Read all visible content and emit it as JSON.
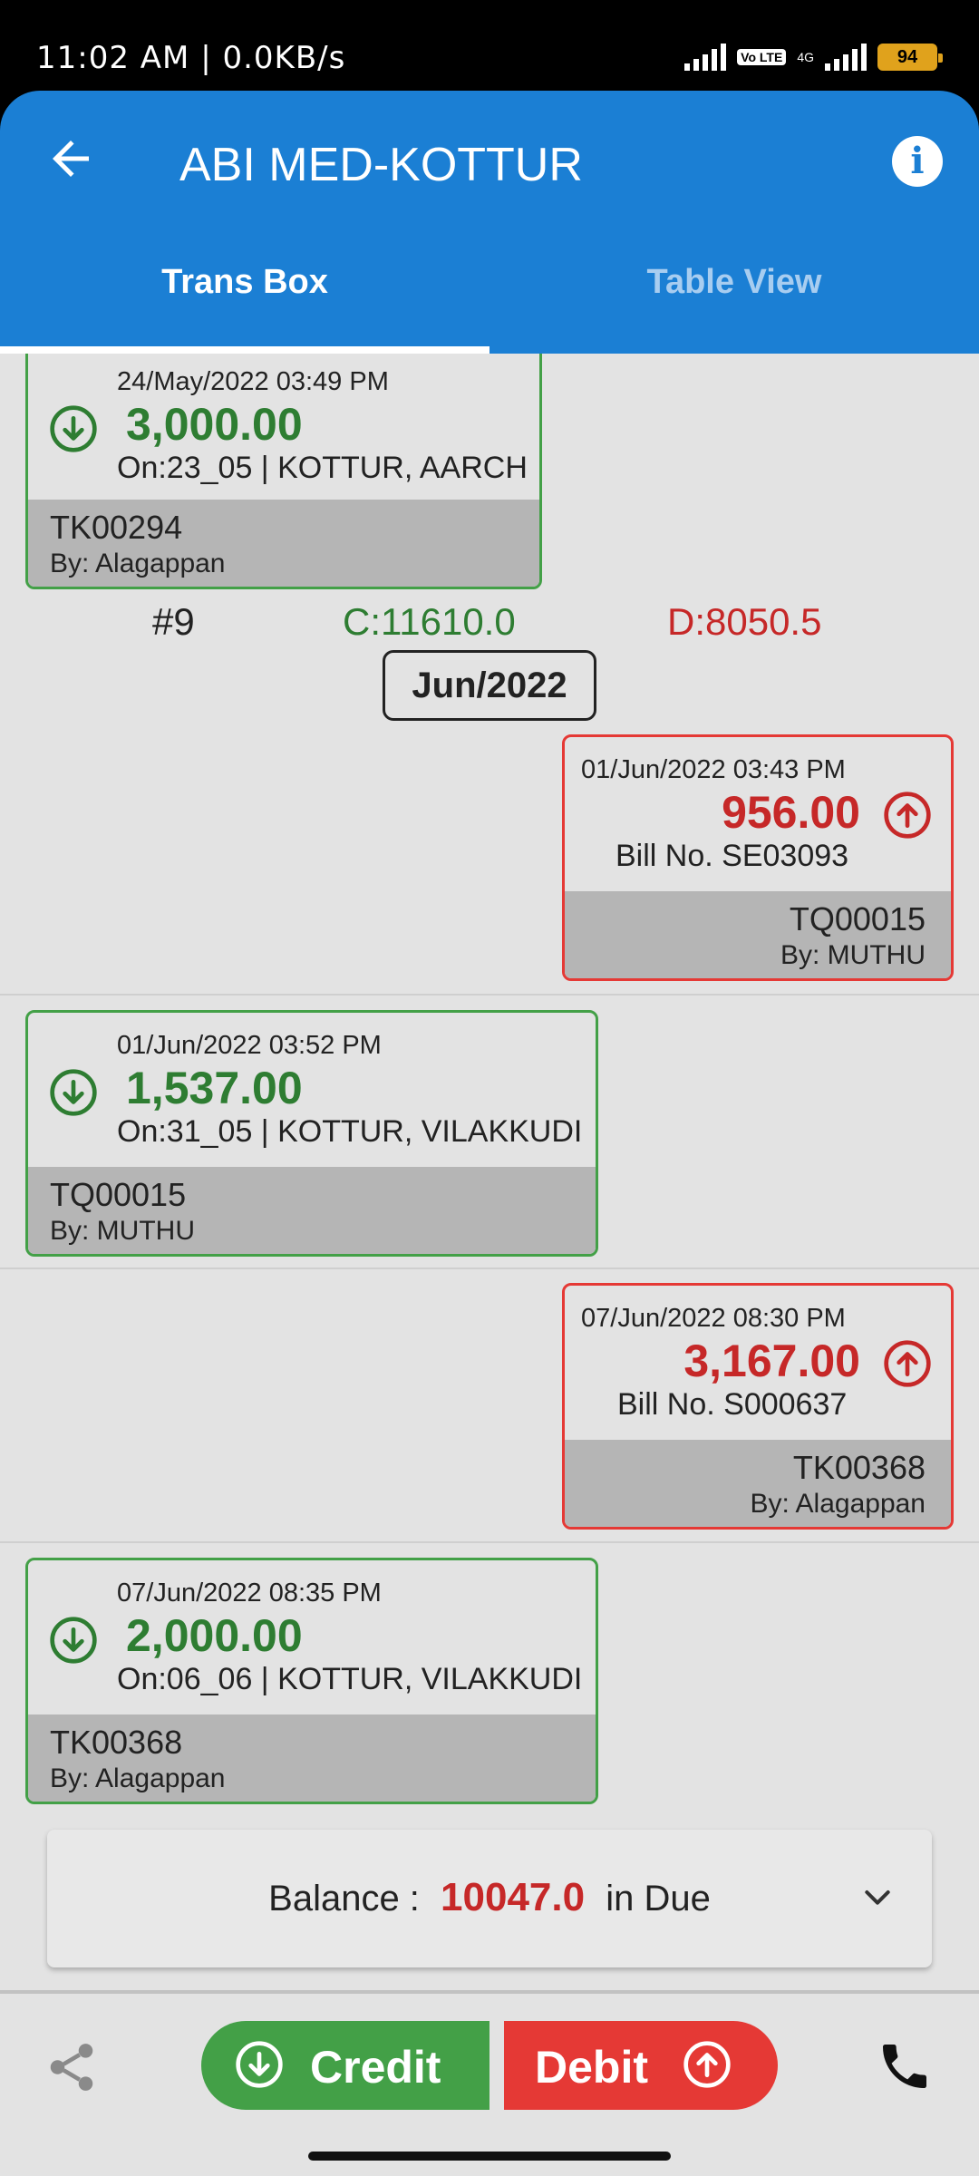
{
  "status_bar": {
    "time": "11:02 AM | 0.0KB/s",
    "volte": "Vo LTE",
    "network": "4G",
    "battery": "94"
  },
  "header": {
    "title": "ABI MED-KOTTUR",
    "back_icon": "arrow-left-icon",
    "info_icon": "info-icon"
  },
  "tabs": [
    {
      "label": "Trans Box",
      "active": true
    },
    {
      "label": "Table View",
      "active": false
    }
  ],
  "colors": {
    "primary": "#1b7fd4",
    "credit": "#43a047",
    "credit_text": "#2e7d32",
    "debit": "#e53935",
    "debit_text": "#c62828"
  },
  "transactions": [
    {
      "type": "credit",
      "datetime": "24/May/2022 03:49 PM",
      "amount": "3,000.00",
      "detail": "On:23_05 | KOTTUR, AARCH",
      "ref": "TK00294",
      "by": "By: Alagappan",
      "icon": "arrow-down-circle-icon"
    },
    {
      "type": "debit",
      "datetime": "01/Jun/2022 03:43 PM",
      "amount": "956.00",
      "detail": "Bill No. SE03093",
      "ref": "TQ00015",
      "by": "By: MUTHU",
      "icon": "arrow-up-circle-icon"
    },
    {
      "type": "credit",
      "datetime": "01/Jun/2022 03:52 PM",
      "amount": "1,537.00",
      "detail": "On:31_05 | KOTTUR, VILAKKUDI",
      "ref": "TQ00015",
      "by": "By: MUTHU",
      "icon": "arrow-down-circle-icon"
    },
    {
      "type": "debit",
      "datetime": "07/Jun/2022 08:30 PM",
      "amount": "3,167.00",
      "detail": "Bill No. S000637",
      "ref": "TK00368",
      "by": "By: Alagappan",
      "icon": "arrow-up-circle-icon"
    },
    {
      "type": "credit",
      "datetime": "07/Jun/2022 08:35 PM",
      "amount": "2,000.00",
      "detail": "On:06_06 | KOTTUR, VILAKKUDI",
      "ref": "TK00368",
      "by": "By: Alagappan",
      "icon": "arrow-down-circle-icon"
    }
  ],
  "month_summary": {
    "count": "#9",
    "credit_total": "C:11610.0",
    "debit_total": "D:8050.5",
    "month": "Jun/2022"
  },
  "balance": {
    "label": "Balance :",
    "value": "10047.0",
    "suffix": "in Due",
    "expand_icon": "chevron-down-icon"
  },
  "bottom_bar": {
    "share_icon": "share-icon",
    "credit_label": "Credit",
    "debit_label": "Debit",
    "phone_icon": "phone-icon"
  }
}
